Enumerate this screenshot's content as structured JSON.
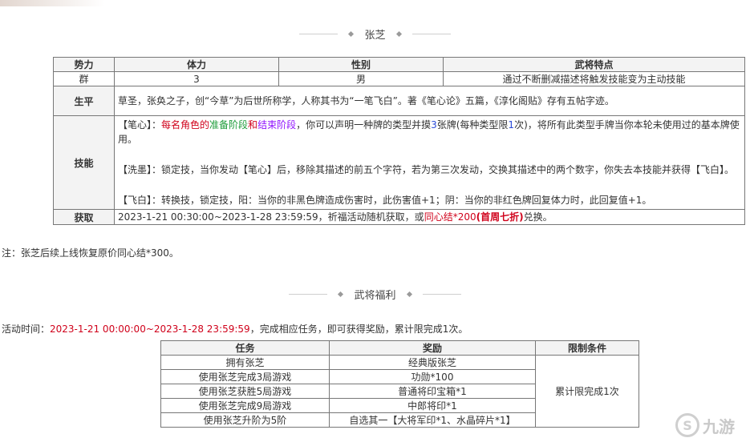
{
  "header": {
    "hero_title": "张芝",
    "welfare_title": "武将福利"
  },
  "info_table": {
    "headers": [
      "势力",
      "体力",
      "性别",
      "武将特点"
    ],
    "values": [
      "群",
      "3",
      "男",
      "通过不断删减描述将触发技能变为主动技能"
    ],
    "bio_label": "生平",
    "bio": "草圣，张奂之子，创“今草”为后世所称学，人称其书为“一笔飞白”。著《笔心论》五篇，《淳化阁贴》存有五帖字迹。",
    "skills_label": "技能",
    "skill1": {
      "name": "【笔心】：",
      "p1": "每名角色的",
      "p2": "准备阶段",
      "p3": "和",
      "p4": "结束阶段",
      "p5": "，你可以声明一种牌的类型并摸",
      "p6": "3",
      "p7": "张牌(每种类型限",
      "p8": "1",
      "p9": "次)，将所有此类型手牌当你本轮未使用过的基本牌使用。"
    },
    "skill2": "【洗墨】：锁定技，当你发动【笔心】后，移除其描述的前五个字符，若为第三次发动，交换其描述中的两个数字，你失去本技能并获得【飞白】。",
    "skill3": "【飞白】：转换技，锁定技，阳：当你的非黑色牌造成伤害时，此伤害值+1；阴：当你的非红色牌回复体力时，此回复值+1。",
    "acquire_label": "获取",
    "acquire": {
      "p1": "2023-1-21 00:30:00~2023-1-28 23:59:59，祈福活动随机获取，或",
      "p2": "同心结*200",
      "p3": "(首周七折)",
      "p4": "兑换。"
    }
  },
  "note": "注：张芝后续上线恢复原价同心结*300。",
  "activity": {
    "label": "活动时间：",
    "time": "2023-1-21 00:00:00~2023-1-28 23:59:59",
    "desc": "，完成相应任务，即可获得奖励，累计限完成1次。"
  },
  "reward_table": {
    "headers": [
      "任务",
      "奖励",
      "限制条件"
    ],
    "rows": [
      [
        "拥有张芝",
        "经典版张芝"
      ],
      [
        "使用张芝完成3局游戏",
        "功勋*100"
      ],
      [
        "使用张芝获胜5局游戏",
        "普通将印宝箱*1"
      ],
      [
        "使用张芝完成9局游戏",
        "中郎将印*1"
      ],
      [
        "使用张芝升阶为5阶",
        "自选其一【大将军印*1、水晶碎片*1】"
      ]
    ],
    "limit": "累计限完成1次"
  },
  "watermark": {
    "text": "九游"
  },
  "colors": {
    "accent_red": "#d0021b",
    "blue": "#2a4bd8",
    "green": "#1e9c3a",
    "purple": "#9013fe"
  }
}
